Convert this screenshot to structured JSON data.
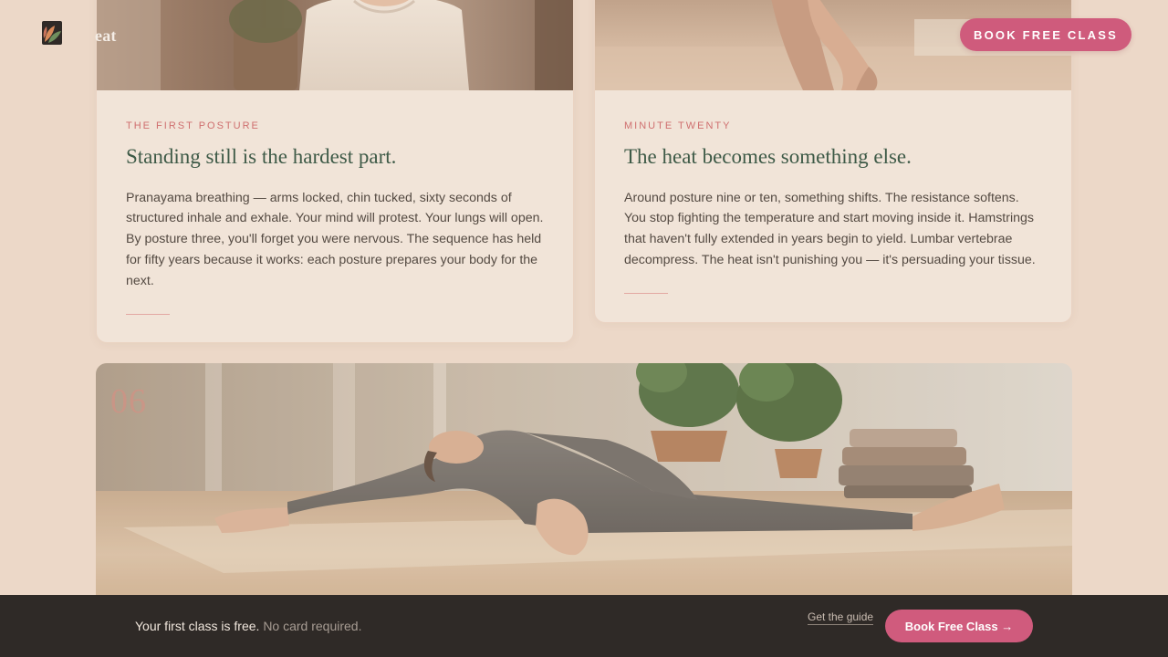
{
  "header": {
    "logo_icon": "leaf-logo-icon",
    "brand_fragment": "eat",
    "cta_label": "BOOK FREE CLASS"
  },
  "cards": [
    {
      "eyebrow": "THE FIRST POSTURE",
      "title": "Standing still is the hardest part.",
      "body": "Pranayama breathing — arms locked, chin tucked, sixty seconds of structured inhale and exhale. Your mind will protest. Your lungs will open. By posture three, you'll forget you were nervous. The sequence has held for fifty years because it works: each posture prepares your body for the next."
    },
    {
      "eyebrow": "MINUTE TWENTY",
      "title": "The heat becomes something else.",
      "body": "Around posture nine or ten, something shifts. The resistance softens. You stop fighting the temperature and start moving inside it. Hamstrings that haven't fully extended in years begin to yield. Lumbar vertebrae decompress. The heat isn't punishing you — it's persuading your tissue."
    }
  ],
  "panel": {
    "number": "06"
  },
  "bottom_bar": {
    "message": "Your first class is free.",
    "message_muted": "No card required.",
    "guide_link": "Get the guide",
    "cta_label": "Book Free Class →"
  },
  "colors": {
    "accent": "#cf5b7c",
    "background": "#ecd8c8",
    "card": "#f1e4d8",
    "title_green": "#3e5a47",
    "eyebrow_coral": "#cf6f6f",
    "bar": "#2f2a27"
  }
}
